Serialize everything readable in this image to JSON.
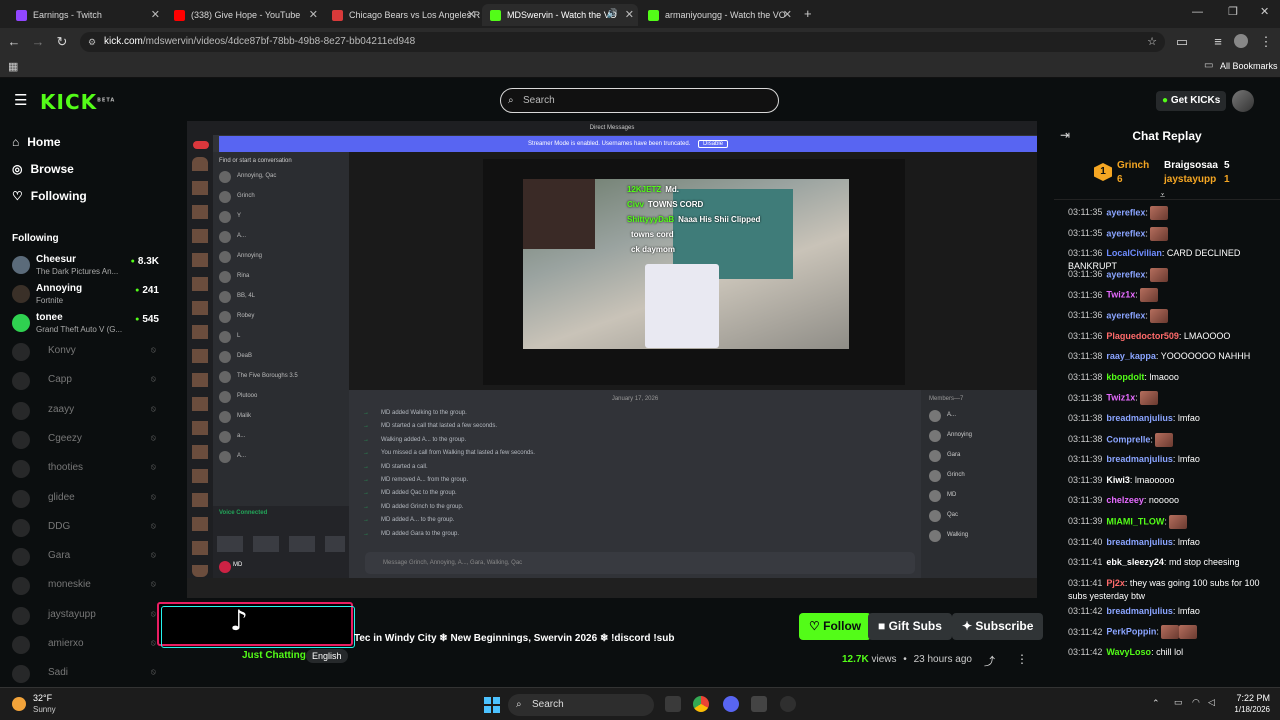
{
  "browser": {
    "tabs": [
      {
        "title": "Earnings - Twitch",
        "color": "#9146ff"
      },
      {
        "title": "(338) Give Hope - YouTube",
        "color": "#ff0000"
      },
      {
        "title": "Chicago Bears vs Los Angeles R",
        "color": "#d83a3a"
      },
      {
        "title": "MDSwervin - Watch the VO",
        "color": "#53fc18"
      },
      {
        "title": "armaniyoungg - Watch the VO",
        "color": "#53fc18"
      }
    ],
    "url_host": "kick.com",
    "url_path": "/mdswervin/videos/4dce87bf-78bb-49b8-8e27-bb04211ed948",
    "bookmarks_label": "All Bookmarks"
  },
  "topnav": {
    "logo": "KICK",
    "logo_tag": "BETA",
    "search_placeholder": "Search",
    "get_kicks": "Get KICKs"
  },
  "sidebar": {
    "nav": [
      {
        "label": "Home",
        "icon": "home-icon"
      },
      {
        "label": "Browse",
        "icon": "compass-icon"
      },
      {
        "label": "Following",
        "icon": "heart-icon"
      }
    ],
    "following_heading": "Following",
    "live": [
      {
        "name": "Cheesur",
        "category": "The Dark Pictures An...",
        "viewers": "8.3K"
      },
      {
        "name": "Annoying",
        "category": "Fortnite",
        "viewers": "241"
      },
      {
        "name": "tonee",
        "category": "Grand Theft Auto V (G...",
        "viewers": "545"
      }
    ],
    "offline": [
      "Konvy",
      "Capp",
      "zaayy",
      "Cgeezy",
      "thooties",
      "glidee",
      "DDG",
      "Gara",
      "moneskie",
      "jaystayupp",
      "amierxo",
      "Sadi"
    ]
  },
  "video": {
    "discord_title": "Direct Messages",
    "banner": "Streamer Mode is enabled. Usernames have been truncated.",
    "banner_button": "Disable",
    "find_placeholder": "Find or start a conversation",
    "dms": [
      "Annoying, Qac",
      "Grinch",
      "Y",
      "A...",
      "Annoying",
      "Rina",
      "BB, 4L",
      "Robey",
      "L",
      "DeaB",
      "The Five Boroughs 3.5",
      "Plutooo",
      "Malik",
      "a...",
      "A..."
    ],
    "overlay_chat": [
      {
        "user": "12KJETZ",
        "text": "Md."
      },
      {
        "user": "Civv",
        "text": "TOWNS CORD"
      },
      {
        "user": "ShittyyyDaB",
        "text": "Naaa His Shii Clipped"
      },
      {
        "user": "",
        "text": "towns cord"
      },
      {
        "user": "",
        "text": "ck daymom"
      }
    ],
    "date_divider": "January 17, 2026",
    "messages": [
      "MD added Walking to the group.",
      "MD started a call that lasted a few seconds.",
      "Walking added A... to the group.",
      "You missed a call from Walking that lasted a few seconds.",
      "MD started a call.",
      "MD removed A... from the group.",
      "MD added Qac to the group.",
      "MD added Grinch to the group.",
      "MD added A... to the group.",
      "MD added Gara to the group."
    ],
    "members_heading": "Members—7",
    "members": [
      "A...",
      "Annoying",
      "Gara",
      "Grinch",
      "MD",
      "Qac",
      "Walking"
    ],
    "compose_placeholder": "Message Grinch, Annoying, A..., Gara, Walking, Qac",
    "voice_status": "Voice Connected",
    "user_name": "MD"
  },
  "stream": {
    "title": "Tec in Windy City ❄ New Beginnings, Swervin 2026 ❄ !discord !sub",
    "category": "Just Chatting",
    "language": "English",
    "follow": "Follow",
    "gift": "Gift Subs",
    "subscribe": "Subscribe",
    "views": "12.7K",
    "views_label": "views",
    "age": "23 hours ago"
  },
  "chat": {
    "title": "Chat Replay",
    "pinned": [
      {
        "user": "Grinch",
        "count": "6",
        "color": "#f5a623"
      },
      {
        "user": "Braigsosaa",
        "count": "5",
        "color": "#ffffff"
      },
      {
        "user": "jaystayupp",
        "count": "1",
        "color": "#f5a623"
      }
    ],
    "messages": [
      {
        "time": "03:11:35",
        "user": "ayereflex",
        "color": "#8aa4ff",
        "text": "",
        "emote": 1
      },
      {
        "time": "03:11:35",
        "user": "ayereflex",
        "color": "#8aa4ff",
        "text": "",
        "emote": 1
      },
      {
        "time": "03:11:36",
        "user": "LocalCivilian",
        "color": "#6f8cff",
        "text": "CARD DECLINED BANKRUPT",
        "emote": 0
      },
      {
        "time": "03:11:36",
        "user": "ayereflex",
        "color": "#8aa4ff",
        "text": "",
        "emote": 1
      },
      {
        "time": "03:11:36",
        "user": "Twiz1x",
        "color": "#e66bff",
        "text": "",
        "emote": 1
      },
      {
        "time": "03:11:36",
        "user": "ayereflex",
        "color": "#8aa4ff",
        "text": "",
        "emote": 1
      },
      {
        "time": "03:11:36",
        "user": "Plaguedoctor509",
        "color": "#ff6b6b",
        "text": "LMAOOOO",
        "emote": 0
      },
      {
        "time": "03:11:38",
        "user": "raay_kappa",
        "color": "#8aa4ff",
        "text": "YOOOOOOO NAHHH",
        "emote": 0
      },
      {
        "time": "03:11:38",
        "user": "kbopdolt",
        "color": "#53fc18",
        "text": "lmaooo",
        "emote": 0
      },
      {
        "time": "03:11:38",
        "user": "Twiz1x",
        "color": "#e66bff",
        "text": "",
        "emote": 1
      },
      {
        "time": "03:11:38",
        "user": "breadmanjulius",
        "color": "#8aa4ff",
        "text": "lmfao",
        "emote": 0
      },
      {
        "time": "03:11:38",
        "user": "Comprelle",
        "color": "#8aa4ff",
        "text": "",
        "emote": 1
      },
      {
        "time": "03:11:39",
        "user": "breadmanjulius",
        "color": "#8aa4ff",
        "text": "lmfao",
        "emote": 0
      },
      {
        "time": "03:11:39",
        "user": "Kiwi3",
        "color": "#ffffff",
        "text": "lmaooooo",
        "emote": 0
      },
      {
        "time": "03:11:39",
        "user": "chelzeey",
        "color": "#e66bff",
        "text": "nooooo",
        "emote": 0
      },
      {
        "time": "03:11:39",
        "user": "MIAMI_TLOW",
        "color": "#53fc18",
        "text": "",
        "emote": 1
      },
      {
        "time": "03:11:40",
        "user": "breadmanjulius",
        "color": "#8aa4ff",
        "text": "lmfao",
        "emote": 0
      },
      {
        "time": "03:11:41",
        "user": "ebk_sleezy24",
        "color": "#ffffff",
        "text": "md stop cheesing",
        "emote": 0
      },
      {
        "time": "03:11:41",
        "user": "Pj2x",
        "color": "#ff6b6b",
        "text": "they was going 100 subs for 100 subs yesterday btw",
        "emote": 0
      },
      {
        "time": "03:11:42",
        "user": "breadmanjulius",
        "color": "#8aa4ff",
        "text": "lmfao",
        "emote": 0
      },
      {
        "time": "03:11:42",
        "user": "PerkPoppin",
        "color": "#8aa4ff",
        "text": "",
        "emote": 2
      },
      {
        "time": "03:11:42",
        "user": "WavyLoso",
        "color": "#53fc18",
        "text": "chill lol",
        "emote": 0
      }
    ]
  },
  "taskbar": {
    "temp": "32°F",
    "condition": "Sunny",
    "search": "Search",
    "time": "7:22 PM",
    "date": "1/18/2026"
  },
  "colors": {
    "accent": "#53fc18",
    "background": "#0b0e0f",
    "discord_blurple": "#5865f2"
  }
}
